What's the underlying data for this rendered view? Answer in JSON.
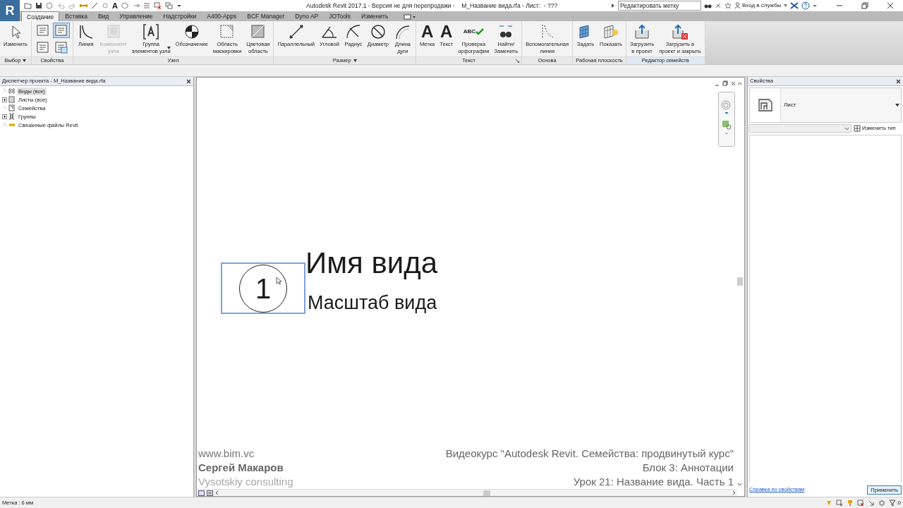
{
  "app_menu": {
    "letter": "R"
  },
  "quick_access": {
    "glyph": "A"
  },
  "window": {
    "title": "Autodesk Revit 2017.1 - Версия не для перепродажи -    M_Название вида.rfa - Лист:  - ???"
  },
  "search": {
    "value": "Редактировать метку"
  },
  "sign_in": {
    "label": "Вход в службы"
  },
  "tabs": [
    {
      "label": "Создание",
      "selected": true
    },
    {
      "label": "Вставка",
      "selected": false
    },
    {
      "label": "Вид",
      "selected": false
    },
    {
      "label": "Управление",
      "selected": false
    },
    {
      "label": "Надстройки",
      "selected": false
    },
    {
      "label": "A400-Apps",
      "selected": false
    },
    {
      "label": "BCF Manager",
      "selected": false
    },
    {
      "label": "Dyno AP",
      "selected": false
    },
    {
      "label": "JOTools",
      "selected": false
    },
    {
      "label": "Изменить",
      "selected": false
    }
  ],
  "ribbon_panels": [
    {
      "title": "Выбор",
      "has_menu": true,
      "tools": [
        {
          "label": "Изменить",
          "disabled": false
        }
      ]
    },
    {
      "title": "Свойства",
      "kind": "small",
      "toggles": [
        {
          "selected": false
        },
        {
          "selected": true
        },
        {
          "selected": false
        },
        {
          "selected": false
        }
      ]
    },
    {
      "title": "Узел",
      "tools": [
        {
          "label": "Линия",
          "disabled": false
        },
        {
          "label": "Компонент\nузла",
          "disabled": true
        },
        {
          "label": "Группа\nэлементов узла",
          "disabled": false,
          "dropdown": true
        },
        {
          "label": "Обозначение",
          "disabled": false
        },
        {
          "label": "Область\nмаскировки",
          "disabled": false
        },
        {
          "label": "Цветовая\nобласть",
          "disabled": false
        }
      ]
    },
    {
      "title": "Размер",
      "has_menu": true,
      "tools": [
        {
          "label": "Параллельный",
          "disabled": false
        },
        {
          "label": "Угловой",
          "disabled": false
        },
        {
          "label": "Радиус",
          "disabled": false
        },
        {
          "label": "Диаметр",
          "disabled": false
        },
        {
          "label": "Длина\nдуги",
          "disabled": false
        }
      ]
    },
    {
      "title": "Текст",
      "dialog_launcher": true,
      "tools": [
        {
          "label": "Метка",
          "disabled": false,
          "glyph": "A"
        },
        {
          "label": "Текст",
          "disabled": false,
          "glyph": "A"
        },
        {
          "label": "Проверка\nорфографии",
          "disabled": false,
          "glyph": "ABC"
        },
        {
          "label": "Найти/\nЗаменить",
          "disabled": false
        }
      ]
    },
    {
      "title": "Основа",
      "tools": [
        {
          "label": "Вспомогательная\nлиния",
          "disabled": false
        }
      ]
    },
    {
      "title": "Рабочая плоскость",
      "tools": [
        {
          "label": "Задать",
          "disabled": false
        },
        {
          "label": "Показать",
          "disabled": false
        }
      ]
    },
    {
      "title": "Редактор семейств",
      "highlighted": true,
      "tools": [
        {
          "label": "Загрузить\nв проект",
          "disabled": false
        },
        {
          "label": "Загрузить в\nпроект и закрыть",
          "disabled": false
        }
      ]
    }
  ],
  "project_browser": {
    "title": "Диспетчер проекта - M_Название вида.rfa",
    "items": [
      {
        "label": "Виды (все)",
        "selected": true,
        "expandable": false
      },
      {
        "label": "Листы (все)",
        "selected": false,
        "expandable": true
      },
      {
        "label": "Семейства",
        "selected": false,
        "expandable": false
      },
      {
        "label": "Группы",
        "selected": false,
        "expandable": true
      },
      {
        "label": "Связанные файлы Revit",
        "selected": false,
        "expandable": false
      }
    ]
  },
  "canvas": {
    "view_tag": {
      "number": "1",
      "selected": true
    },
    "view_name": "Имя вида",
    "view_scale": "Масштаб вида",
    "captions_left": [
      {
        "text": "www.bim.vc"
      },
      {
        "text": "Сергей Макаров"
      },
      {
        "text": "Vysotskiy consulting"
      }
    ],
    "captions_right": [
      {
        "text": "Видеокурс \"Autodesk Revit. Семейства: продвинутый курс\""
      },
      {
        "text": "Блок 3: Аннотации"
      },
      {
        "text": "Урок 21: Название вида. Часть 1"
      }
    ]
  },
  "properties": {
    "title": "Свойства",
    "type_name": "Лист",
    "edit_type": "Изменить тип",
    "help_link": "Справка по свойствам",
    "apply_button": "Применить"
  },
  "status_bar": {
    "text": "Метка : 6 мм",
    "filter_count": ":0"
  }
}
